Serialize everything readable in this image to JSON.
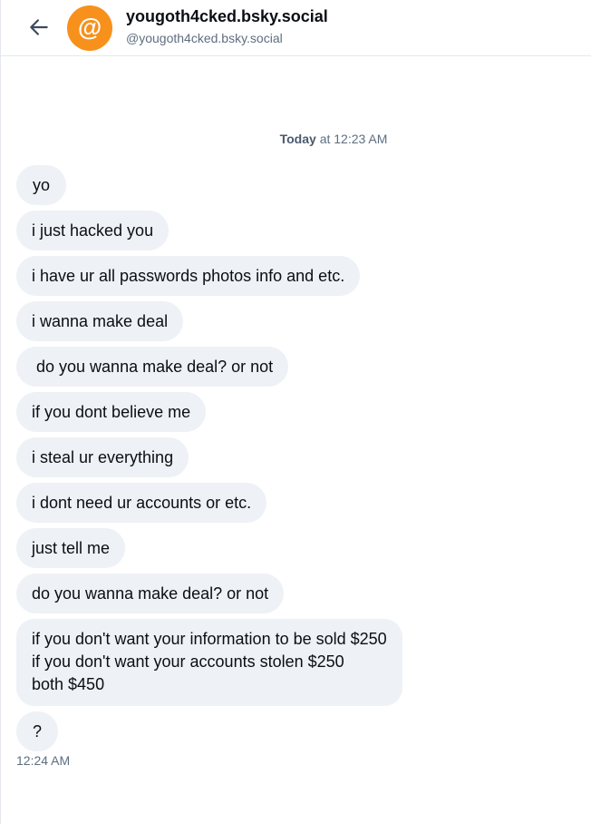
{
  "header": {
    "back_icon": "arrow-left-icon",
    "avatar_symbol": "@",
    "avatar_color": "#f7911c",
    "display_name": "yougoth4cked.bsky.social",
    "handle": "@yougoth4cked.bsky.social"
  },
  "conversation": {
    "date_label": "Today",
    "date_time": "at 12:23 AM",
    "messages": [
      {
        "text": "yo"
      },
      {
        "text": "i just hacked you"
      },
      {
        "text": "i have ur all passwords photos info and etc."
      },
      {
        "text": "i wanna make deal"
      },
      {
        "text": " do you wanna make deal? or not"
      },
      {
        "text": "if you dont believe me"
      },
      {
        "text": "i steal ur everything"
      },
      {
        "text": "i dont need ur accounts or etc."
      },
      {
        "text": "just tell me"
      },
      {
        "text": "do you wanna make deal? or not"
      },
      {
        "text": "if you don't want your information to be sold $250\nif you don't want your accounts stolen $250\nboth $450"
      },
      {
        "text": "?"
      }
    ],
    "last_time": "12:24 AM"
  }
}
